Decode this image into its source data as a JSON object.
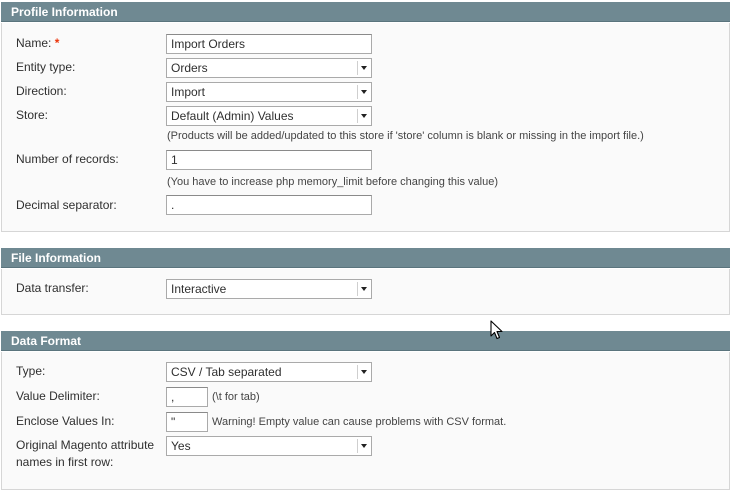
{
  "profile": {
    "header": "Profile Information",
    "name_label": "Name:",
    "required_mark": "*",
    "name_value": "Import Orders",
    "entity_label": "Entity type:",
    "entity_value": "Orders",
    "direction_label": "Direction:",
    "direction_value": "Import",
    "store_label": "Store:",
    "store_value": "Default (Admin) Values",
    "store_note": "(Products will be added/updated to this store if 'store' column is blank or missing in the import file.)",
    "records_label": "Number of records:",
    "records_value": "1",
    "records_note": "(You have to increase php memory_limit before changing this value)",
    "decimal_label": "Decimal separator:",
    "decimal_value": "."
  },
  "file": {
    "header": "File Information",
    "transfer_label": "Data transfer:",
    "transfer_value": "Interactive"
  },
  "format": {
    "header": "Data Format",
    "type_label": "Type:",
    "type_value": "CSV / Tab separated",
    "delimiter_label": "Value Delimiter:",
    "delimiter_value": ",",
    "delimiter_note": "(\\t for tab)",
    "enclose_label": "Enclose Values In:",
    "enclose_value": "\"",
    "enclose_note": "Warning! Empty value can cause problems with CSV format.",
    "original_label_line1": "Original Magento attribute",
    "original_label_line2": "names in first row:",
    "original_value": "Yes"
  }
}
